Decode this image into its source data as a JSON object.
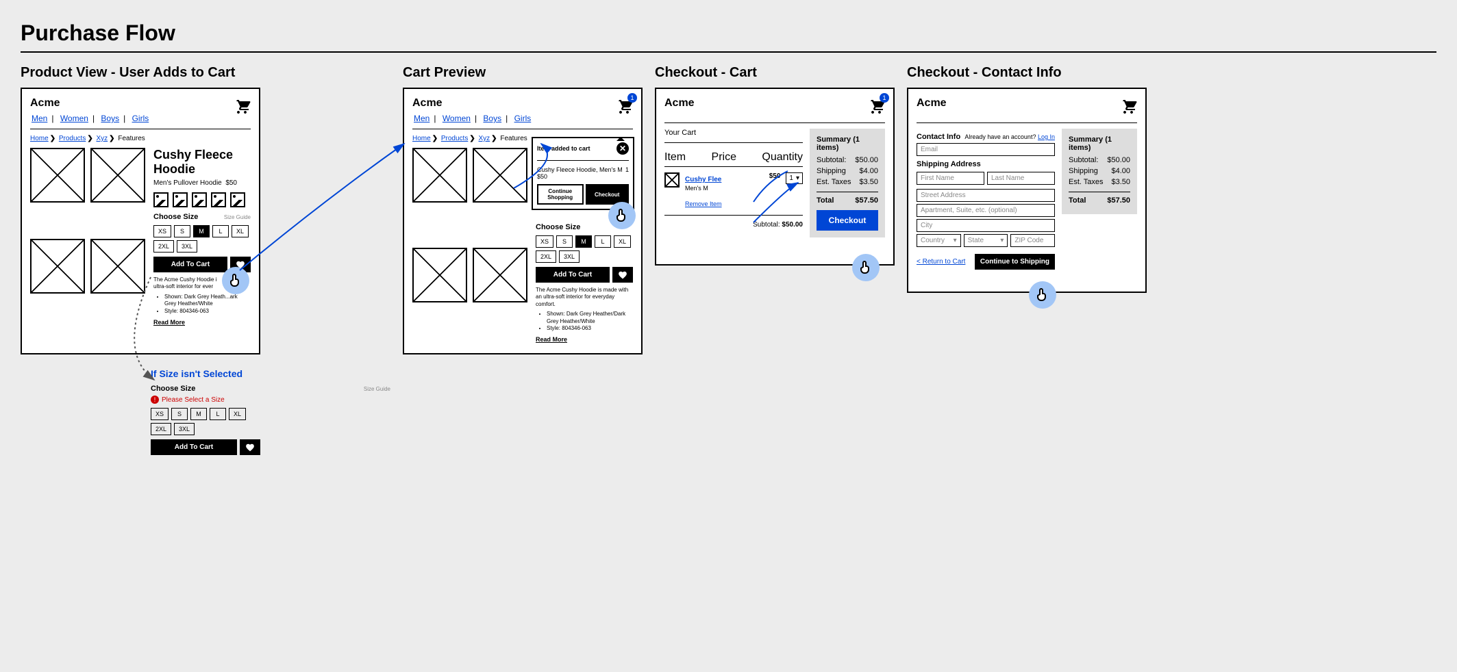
{
  "flow_title": "Purchase Flow",
  "panels": {
    "p1": {
      "title": "Product View - User Adds to Cart"
    },
    "p2": {
      "title": "Cart Preview"
    },
    "p3": {
      "title": "Checkout - Cart"
    },
    "p4": {
      "title": "Checkout - Contact Info"
    }
  },
  "brand": "Acme",
  "nav": {
    "men": "Men",
    "women": "Women",
    "boys": "Boys",
    "girls": "Girls"
  },
  "breadcrumb": {
    "home": "Home",
    "products": "Products",
    "xyz": "Xyz",
    "features": "Features"
  },
  "product": {
    "name": "Cushy Fleece Hoodie",
    "subtitle": "Men's Pullover Hoodie",
    "price": "$50",
    "choose_size": "Choose Size",
    "size_guide": "Size Guide",
    "sizes": {
      "xs": "XS",
      "s": "S",
      "m": "M",
      "l": "L",
      "xl": "XL",
      "xxl": "2XL",
      "xxxl": "3XL"
    },
    "add_to_cart": "Add To Cart",
    "desc_short_p1": "The Acme Cushy Hoodie i",
    "desc_short_p2": "ultra-soft interior for ever",
    "desc_full": "The Acme Cushy Hoodie is made with an ultra-soft interior for everyday comfort.",
    "bullet1": "Shown: Dark Grey Heather/Dark Grey Heather/White",
    "bullet1_trunc": "Shown: Dark Grey Heath...ark Grey Heather/White",
    "bullet2": "Style: 804346-063",
    "read_more": "Read More"
  },
  "error_state": {
    "title": "If Size isn't Selected",
    "msg": "Please Select a Size"
  },
  "popup": {
    "head": "Item added to cart",
    "line1": "Cushy Fleece Hoodie, Men's M",
    "qty": "1",
    "price": "$50",
    "continue": "Continue Shopping",
    "checkout": "Checkout"
  },
  "cart": {
    "your_cart": "Your Cart",
    "col_item": "Item",
    "col_price": "Price",
    "col_qty": "Quantity",
    "item_name": "Cushy Flee",
    "item_variant": "Men's M",
    "item_price": "$50",
    "item_qty": "1",
    "remove": "Remove Item",
    "subtotal_label": "Subtotal:",
    "subtotal_value": "$50.00"
  },
  "summary": {
    "title": "Summary (1 items)",
    "subtotal_l": "Subtotal:",
    "subtotal_v": "$50.00",
    "shipping_l": "Shipping",
    "shipping_v": "$4.00",
    "tax_l": "Est. Taxes",
    "tax_v": "$3.50",
    "total_l": "Total",
    "total_v": "$57.50",
    "checkout": "Checkout"
  },
  "cart_badge": "1",
  "contact": {
    "label": "Contact Info",
    "already": "Already have an account?",
    "login": "Log In",
    "email_ph": "Email",
    "ship_label": "Shipping Address",
    "first_ph": "First Name",
    "last_ph": "Last Name",
    "street_ph": "Street Address",
    "apt_ph": "Apartment, Suite, etc. (optional)",
    "city_ph": "City",
    "country_ph": "Country",
    "state_ph": "State",
    "zip_ph": "ZIP Code",
    "return": "< Return to Cart",
    "continue": "Continue to Shipping"
  }
}
